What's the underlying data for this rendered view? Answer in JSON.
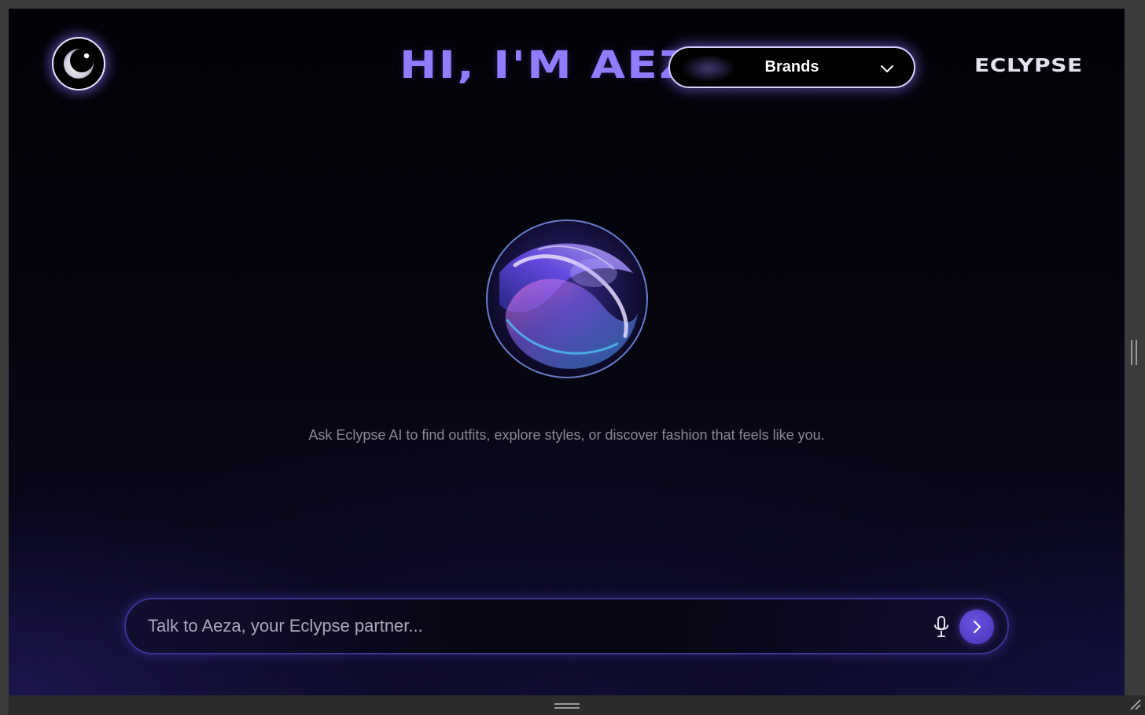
{
  "header": {
    "title": "HI, I'M AEZA",
    "brand": "ECLYPSE",
    "logo_icon": "eclipse-moon-icon"
  },
  "dropdown": {
    "selected": "Brands",
    "icon": "chevron-down-icon"
  },
  "main": {
    "orb_icon": "ai-orb-icon",
    "tagline": "Ask Eclypse AI to find outfits, explore styles, or discover fashion that feels like you."
  },
  "chat": {
    "placeholder": "Talk to Aeza, your Eclypse partner...",
    "mic_icon": "microphone-icon",
    "send_icon": "chevron-right-icon"
  },
  "colors": {
    "accent": "#8f7cff",
    "send": "#5a42d0",
    "background": "#05050f"
  }
}
